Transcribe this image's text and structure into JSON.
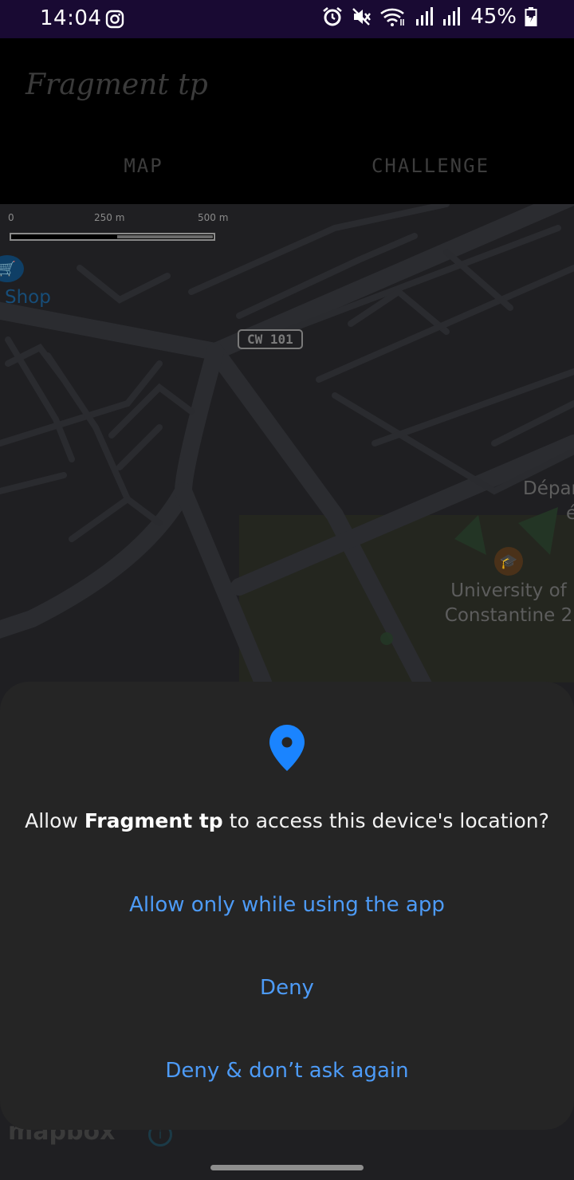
{
  "status_bar": {
    "time": "14:04",
    "battery": "45%",
    "icons": [
      "instagram-icon",
      "alarm-icon",
      "mute-icon",
      "wifi-icon",
      "signal-icon",
      "signal-icon",
      "battery-icon"
    ]
  },
  "app_bar": {
    "title": "Fragment tp",
    "tabs": [
      {
        "label": "MAP"
      },
      {
        "label": "CHALLENGE"
      }
    ]
  },
  "map": {
    "scale": {
      "start": "0",
      "mid": "250 m",
      "end": "500 m"
    },
    "shop_label": "Shop",
    "road_shield": "CW 101",
    "university_label_line1": "University of",
    "university_label_line2": "Constantine 2",
    "department_label_line1": "Dépar",
    "department_label_line2": "é",
    "attribution": "mapbox"
  },
  "dialog": {
    "message_prefix": "Allow ",
    "app_name": "Fragment tp",
    "message_suffix": " to access this device's location?",
    "options": [
      {
        "label": "Allow only while using the app"
      },
      {
        "label": "Deny"
      },
      {
        "label": "Deny & don’t ask again"
      }
    ],
    "accent_color": "#4d9bf7",
    "pin_color": "#1a84ff"
  }
}
